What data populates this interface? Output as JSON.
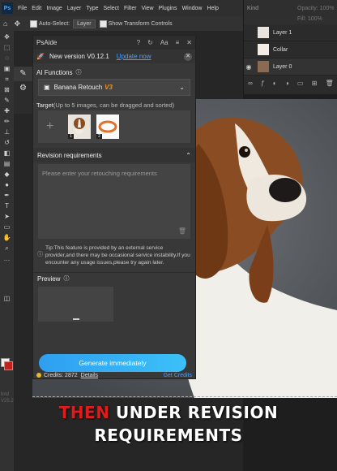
{
  "menubar": {
    "logo": "Ps",
    "items": [
      "File",
      "Edit",
      "Image",
      "Layer",
      "Type",
      "Select",
      "Filter",
      "View",
      "Plugins",
      "Window",
      "Help"
    ]
  },
  "options": {
    "auto_select_label": "Auto-Select:",
    "auto_select_value": "Layer",
    "transform_label": "Show Transform Controls"
  },
  "layers_panel": {
    "kind_label": "Kind",
    "opacity_label": "Opacity:",
    "opacity_value": "100%",
    "fill_label": "Fill:",
    "fill_value": "100%",
    "rows": [
      {
        "name": "Layer 1"
      },
      {
        "name": "Collar"
      },
      {
        "name": "Layer 0"
      }
    ]
  },
  "tool_version": "bnd\nV25.2.0",
  "plugin": {
    "title": "PsAide",
    "new_version_text": "New version V0.12.1",
    "update_link": "Update now",
    "ai_functions_label": "AI Functions",
    "function_name": "Banana Retouch",
    "function_badge": "V3",
    "target_label": "Target",
    "target_hint": "(Up to 5 images, can be dragged and sorted)",
    "thumb1_num": "1",
    "thumb2_num": "2",
    "revision_label": "Revision requirements",
    "revision_placeholder": "Please enter your retouching requirements",
    "tip": "Tip:This feature is provided by an external service provider,and there may be occasional service instability.If you encounter any usage issues,please try again later.",
    "preview_label": "Preview",
    "credits_text": "Credits: 2872",
    "details_link": "Details",
    "get_credits": "Get Credits",
    "generate_button": "Generate immediately"
  },
  "caption": {
    "line1_red": "THEN",
    "line1_white": "UNDER REVISION",
    "line2": "REQUIREMENTS"
  },
  "colors": {
    "accent_blue": "#3aa7f4",
    "caption_red": "#e01b1b",
    "foreground_swatch": "#eeeeee",
    "background_swatch": "#c0201e"
  }
}
